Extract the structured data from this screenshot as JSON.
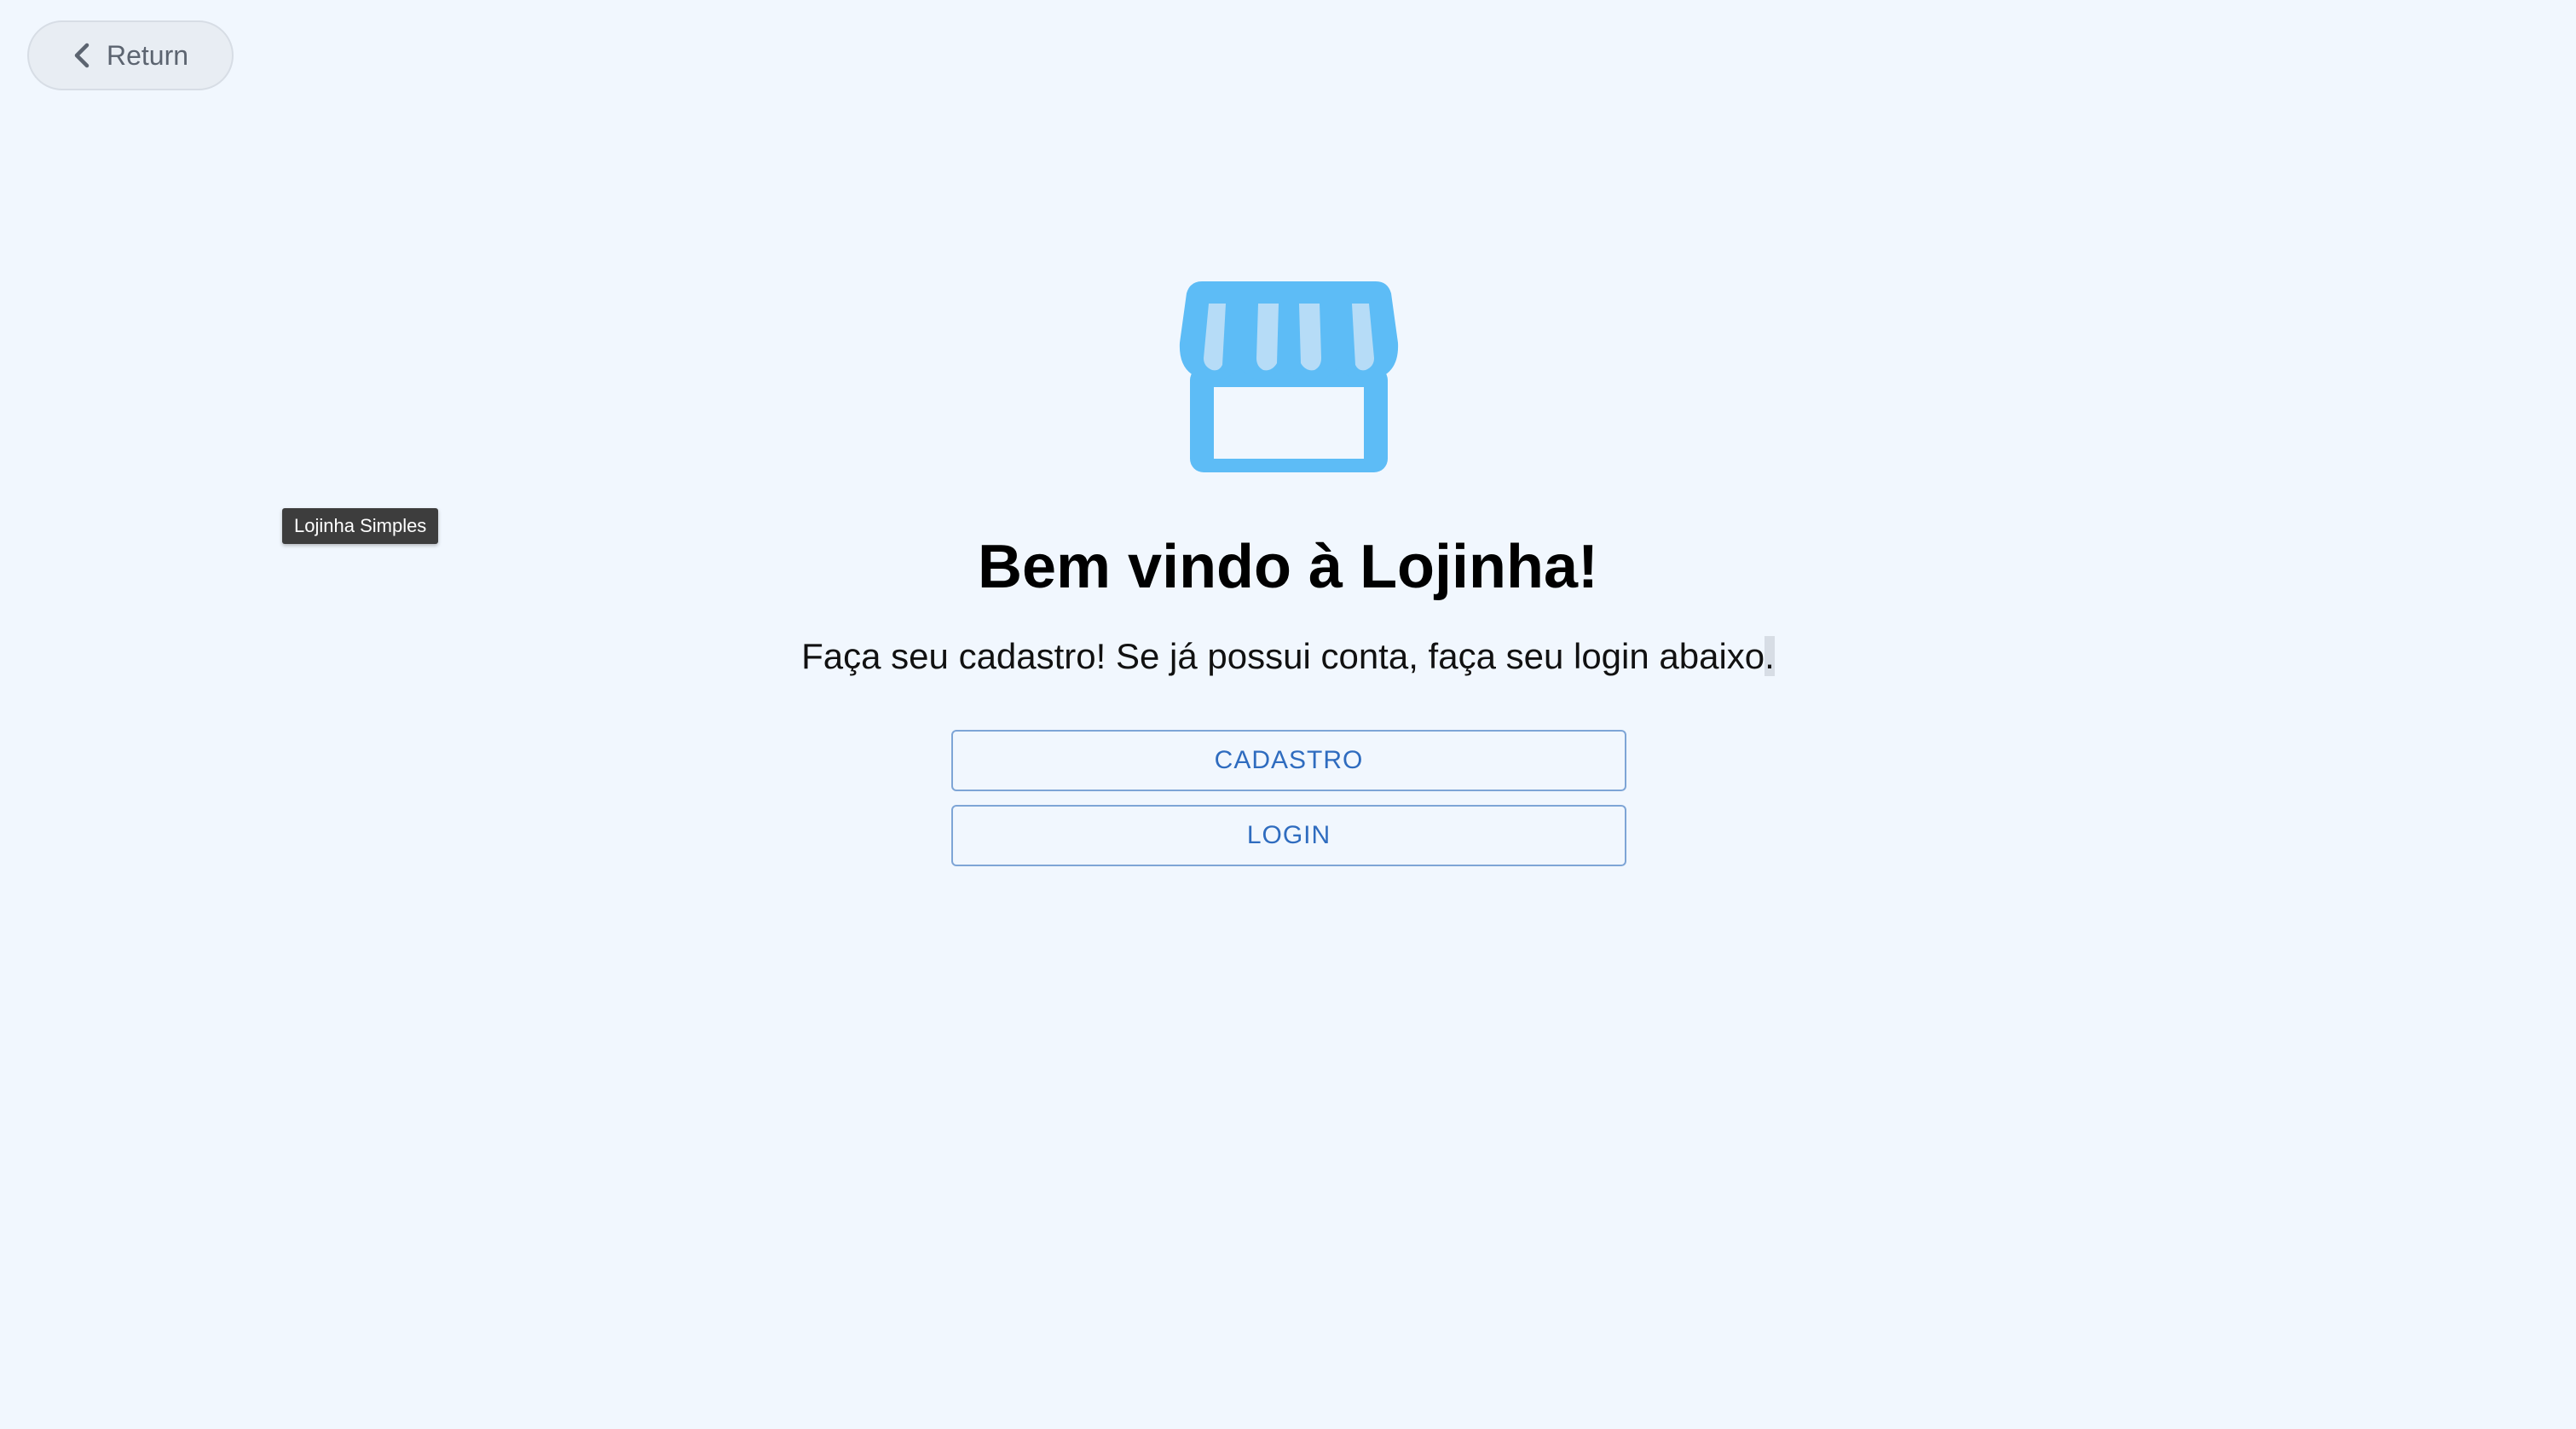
{
  "nav": {
    "return_label": "Return",
    "return_icon": "chevron-left-icon"
  },
  "tooltip": {
    "text": "Lojinha Simples"
  },
  "hero": {
    "icon": "storefront-icon",
    "icon_color": "#5dbcf6",
    "title": "Bem vindo à Lojinha!",
    "subtitle_main": "Faça seu cadastro! Se já possui conta, faça seu login abaixo",
    "subtitle_end": "."
  },
  "actions": {
    "register_label": "CADASTRO",
    "login_label": "LOGIN"
  },
  "colors": {
    "background": "#f1f7fe",
    "button_text": "#2f6cbf",
    "button_border": "#7ea5d6"
  }
}
